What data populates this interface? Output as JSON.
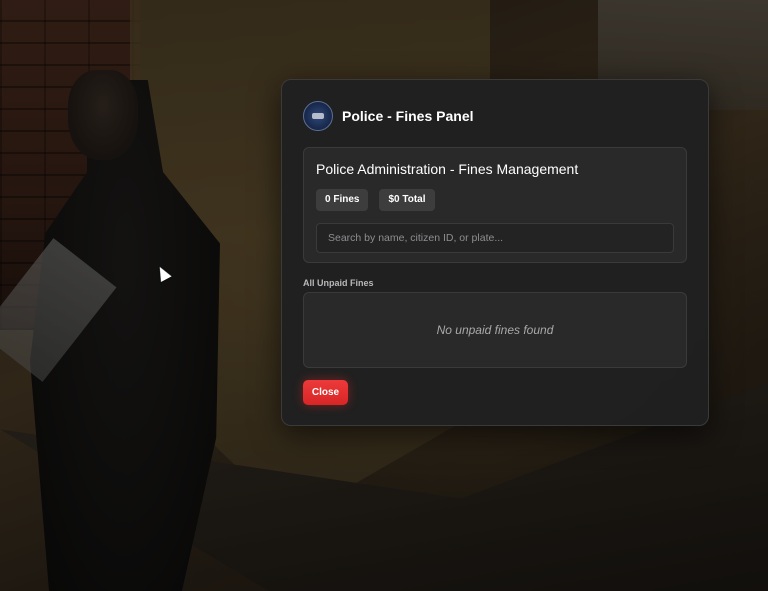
{
  "panel": {
    "title": "Police - Fines Panel",
    "logo_icon": "police-seal-icon"
  },
  "admin": {
    "title": "Police Administration - Fines Management",
    "stats": {
      "fines_count": "0 Fines",
      "total": "$0 Total"
    },
    "search": {
      "placeholder": "Search by name, citizen ID, or plate...",
      "value": ""
    }
  },
  "fines": {
    "section_label": "All Unpaid Fines",
    "empty_message": "No unpaid fines found"
  },
  "actions": {
    "close_label": "Close"
  },
  "colors": {
    "accent": "#e53030",
    "panel_bg": "#202021",
    "card_bg": "#29292a"
  }
}
